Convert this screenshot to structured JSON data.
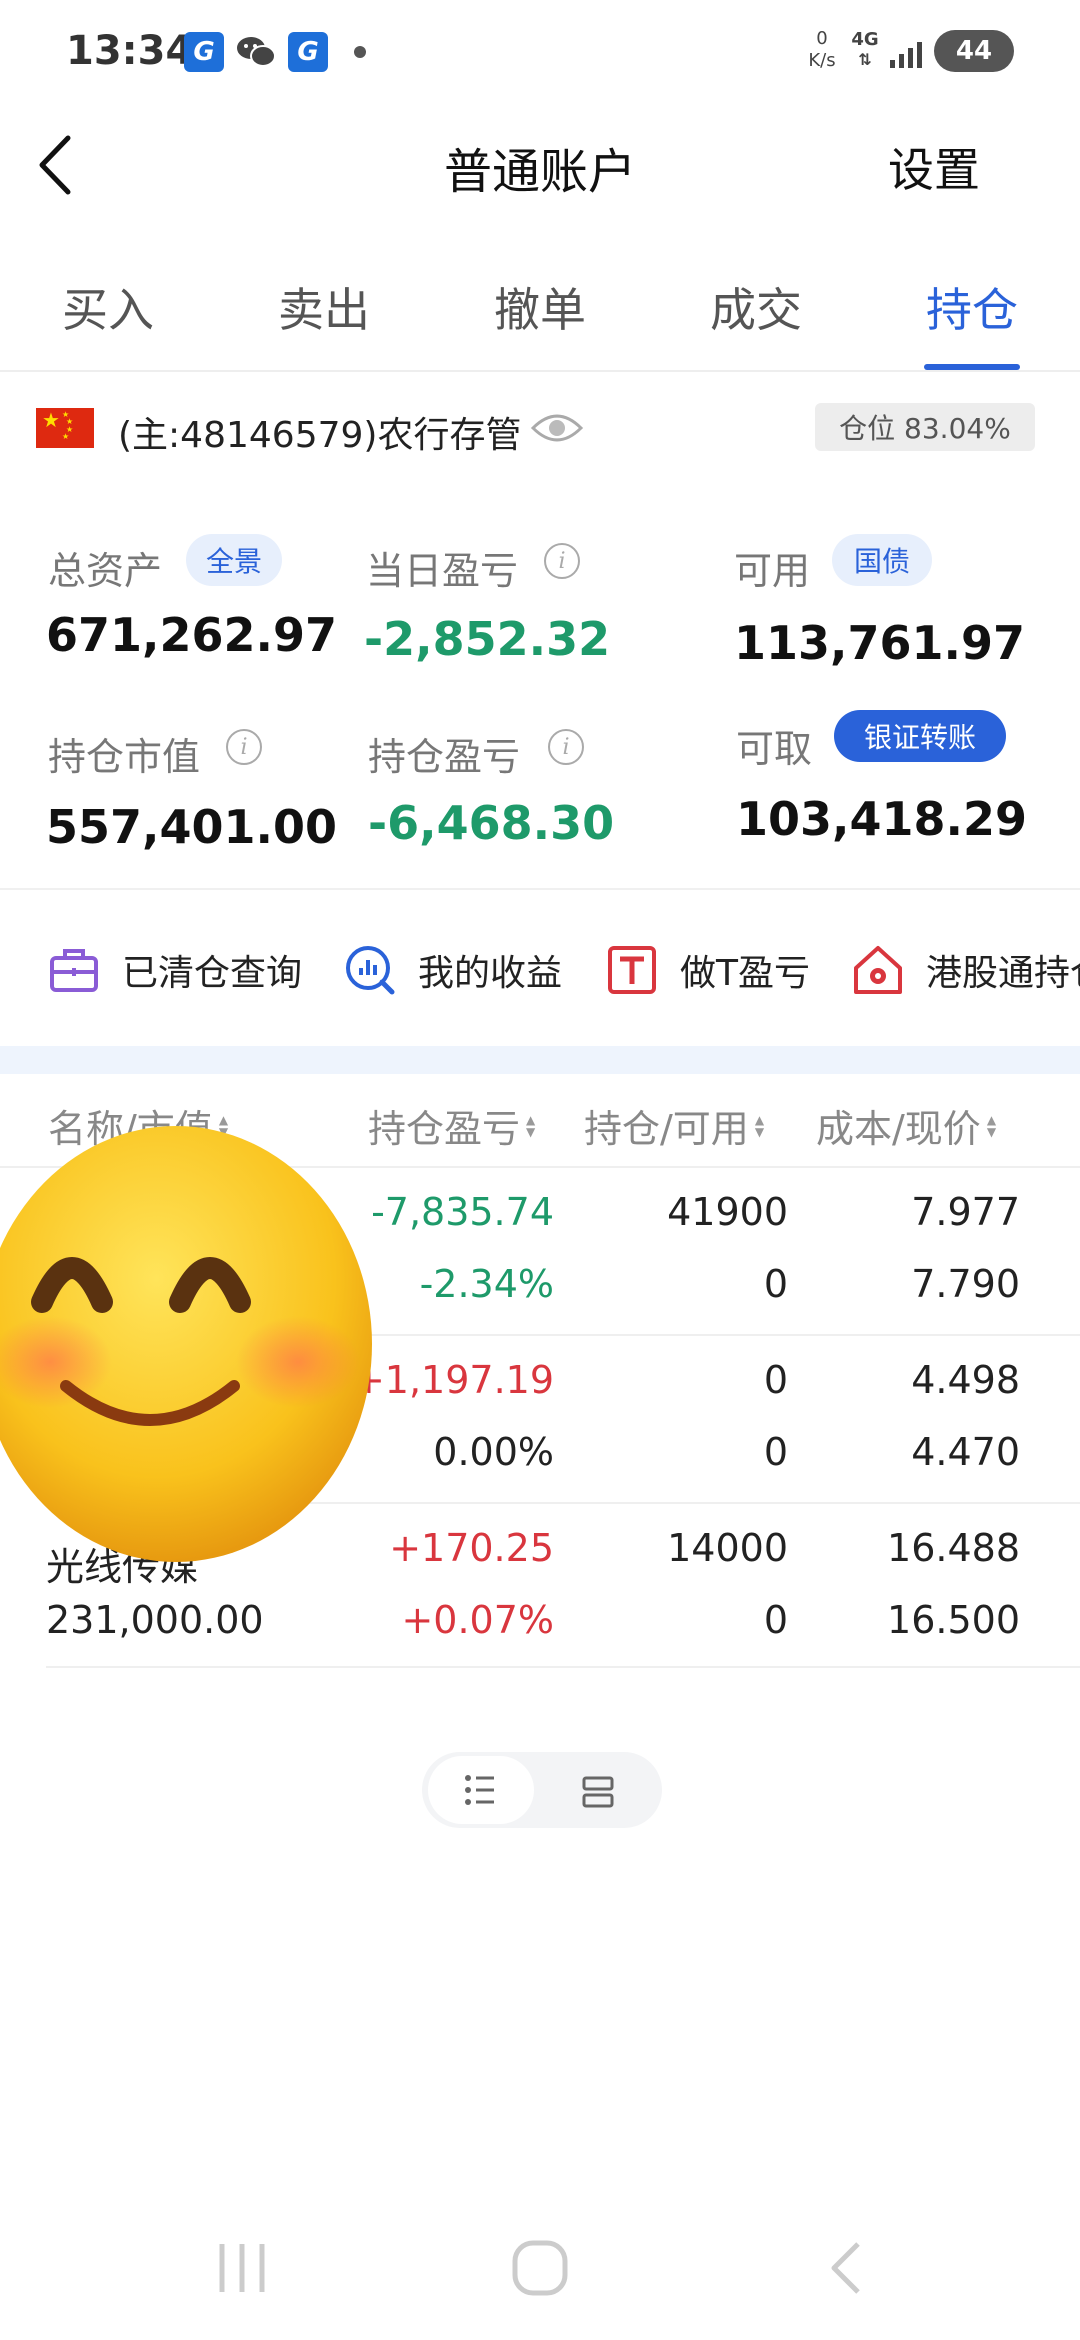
{
  "status_bar": {
    "time": "13:34",
    "app_icon_glyph": "G",
    "net_speed_top": "0",
    "net_speed_bottom": "K/s",
    "network": "4G",
    "battery": "44"
  },
  "header": {
    "title": "普通账户",
    "settings_label": "设置"
  },
  "tabs": [
    {
      "label": "买入",
      "active": false
    },
    {
      "label": "卖出",
      "active": false
    },
    {
      "label": "撤单",
      "active": false
    },
    {
      "label": "成交",
      "active": false
    },
    {
      "label": "持仓",
      "active": true
    }
  ],
  "account": {
    "label": "(主:48146579)农行存管",
    "position_ratio": "仓位 83.04%"
  },
  "summary": {
    "total_assets": {
      "label": "总资产",
      "badge": "全景",
      "value": "671,262.97"
    },
    "daily_pnl": {
      "label": "当日盈亏",
      "value": "-2,852.32"
    },
    "available": {
      "label": "可用",
      "badge": "国债",
      "value": "113,761.97"
    },
    "market_value": {
      "label": "持仓市值",
      "value": "557,401.00"
    },
    "position_pnl": {
      "label": "持仓盈亏",
      "value": "-6,468.30"
    },
    "withdrawable": {
      "label": "可取",
      "badge": "银证转账",
      "value": "103,418.29"
    }
  },
  "shortcuts": [
    {
      "label": "已清仓查询",
      "icon": "briefcase-icon"
    },
    {
      "label": "我的收益",
      "icon": "chart-search-icon"
    },
    {
      "label": "做T盈亏",
      "icon": "t-box-icon"
    },
    {
      "label": "港股通持仓",
      "icon": "hk-flower-icon"
    }
  ],
  "table": {
    "headers": [
      "名称/市值",
      "持仓盈亏",
      "持仓/可用",
      "成本/现价"
    ],
    "rows": [
      {
        "name": "",
        "market_value": "",
        "pnl": "-7,835.74",
        "pnl_pct": "-2.34%",
        "holding": "41900",
        "available": "0",
        "cost": "7.977",
        "price": "7.790",
        "tone": "green"
      },
      {
        "name": "",
        "market_value": "",
        "pnl": "+1,197.19",
        "pnl_pct": "0.00%",
        "holding": "0",
        "available": "0",
        "cost": "4.498",
        "price": "4.470",
        "tone": "red"
      },
      {
        "name": "光线传媒",
        "market_value": "231,000.00",
        "pnl": "+170.25",
        "pnl_pct": "+0.07%",
        "holding": "14000",
        "available": "0",
        "cost": "16.488",
        "price": "16.500",
        "tone": "red"
      }
    ]
  },
  "colors": {
    "accent": "#2a62d9",
    "loss": "#1e9a6a",
    "gain": "#d9363e"
  }
}
